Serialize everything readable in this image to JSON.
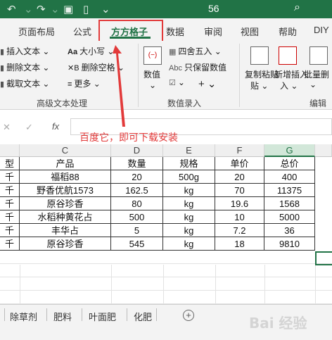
{
  "titlebar": {
    "undo_icon": "undo-icon",
    "redo_icon": "redo-icon",
    "save_icon": "save-icon",
    "new_icon": "new-file-icon",
    "title": "56",
    "search_icon": "search-icon",
    "color": "#217346"
  },
  "tabs": [
    {
      "label": "页面布局"
    },
    {
      "label": "公式"
    },
    {
      "label": "方方格子",
      "active": true
    },
    {
      "label": "数据"
    },
    {
      "label": "审阅"
    },
    {
      "label": "视图"
    },
    {
      "label": "帮助"
    },
    {
      "label": "DIY"
    }
  ],
  "ribbon": {
    "text_group": {
      "insert_text": "插入文本",
      "delete_text": "删除文本",
      "cut_text": "截取文本",
      "case": "大小写",
      "delete_spaces": "删除空格",
      "more": "更多",
      "label": "高级文本处理"
    },
    "entry_group": {
      "value": "数值",
      "round": "四舍五入",
      "keep_value": "只保留数值",
      "label": "数值录入"
    },
    "edit_group": {
      "copy_paste": "复制粘贴",
      "new_insert": "新增插入",
      "batch_delete": "批量删",
      "label": "编辑"
    }
  },
  "formula_bar": {
    "cancel": "✕",
    "confirm": "✓",
    "fx": "fx"
  },
  "annotation": "百度它，即可下载安装",
  "columns": [
    "C",
    "D",
    "E",
    "F",
    "G"
  ],
  "partial_col_label": "型",
  "table": {
    "headers": [
      "产品",
      "数量",
      "规格",
      "单价",
      "总价"
    ],
    "rows": [
      [
        "福稻88",
        "20",
        "500g",
        "20",
        "400"
      ],
      [
        "野香优航1573",
        "162.5",
        "kg",
        "70",
        "11375"
      ],
      [
        "原谷珍香",
        "80",
        "kg",
        "19.6",
        "1568"
      ],
      [
        "水稻种黄花占",
        "500",
        "kg",
        "10",
        "5000"
      ],
      [
        "丰华占",
        "5",
        "kg",
        "7.2",
        "36"
      ],
      [
        "原谷珍香",
        "545",
        "kg",
        "18",
        "9810"
      ]
    ],
    "left_partial": [
      "千",
      "千",
      "千",
      "千",
      "千",
      "千"
    ]
  },
  "sheets": [
    "除草剂",
    "肥料",
    "叶面肥",
    "化肥"
  ],
  "add_sheet": "⊕",
  "watermark": "Bai 经验",
  "accent_red": "#e23a3a"
}
